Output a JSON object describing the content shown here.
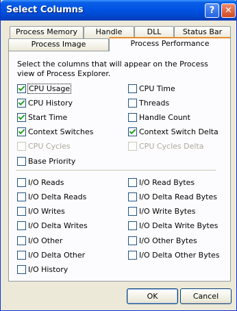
{
  "window": {
    "title": "Select Columns",
    "help_label": "?",
    "close_label": "✕"
  },
  "tabs_back": [
    {
      "label": "Process Memory"
    },
    {
      "label": "Handle"
    },
    {
      "label": "DLL"
    },
    {
      "label": "Status Bar"
    }
  ],
  "tabs_front": [
    {
      "label": "Process Image"
    },
    {
      "label": "Process Performance",
      "active": true
    }
  ],
  "description": "Select the columns that will appear on the Process view of Process Explorer.",
  "checkboxes": [
    {
      "label": "CPU Usage",
      "checked": true,
      "disabled": false
    },
    {
      "label": "CPU Time",
      "checked": false,
      "disabled": false
    },
    {
      "label": "CPU History",
      "checked": true,
      "disabled": false
    },
    {
      "label": "Threads",
      "checked": false,
      "disabled": false
    },
    {
      "label": "Start Time",
      "checked": true,
      "disabled": false
    },
    {
      "label": "Handle Count",
      "checked": false,
      "disabled": false
    },
    {
      "label": "Context Switches",
      "checked": true,
      "disabled": false
    },
    {
      "label": "Context Switch Delta",
      "checked": true,
      "disabled": false
    },
    {
      "label": "CPU Cycles",
      "checked": false,
      "disabled": true
    },
    {
      "label": "CPU Cycles Delta",
      "checked": false,
      "disabled": true
    },
    {
      "label": "Base Priority",
      "checked": false,
      "disabled": false
    },
    {
      "label": "I/O Reads",
      "checked": false,
      "disabled": false
    },
    {
      "label": "I/O Read Bytes",
      "checked": false,
      "disabled": false
    },
    {
      "label": "I/O Delta Reads",
      "checked": false,
      "disabled": false
    },
    {
      "label": "I/O Delta Read Bytes",
      "checked": false,
      "disabled": false
    },
    {
      "label": "I/O Writes",
      "checked": false,
      "disabled": false
    },
    {
      "label": "I/O Write Bytes",
      "checked": false,
      "disabled": false
    },
    {
      "label": "I/O Delta Writes",
      "checked": false,
      "disabled": false
    },
    {
      "label": "I/O Delta Write Bytes",
      "checked": false,
      "disabled": false
    },
    {
      "label": "I/O Other",
      "checked": false,
      "disabled": false
    },
    {
      "label": "I/O Other Bytes",
      "checked": false,
      "disabled": false
    },
    {
      "label": "I/O Delta Other",
      "checked": false,
      "disabled": false
    },
    {
      "label": "I/O Delta Other Bytes",
      "checked": false,
      "disabled": false
    },
    {
      "label": "I/O History",
      "checked": false,
      "disabled": false
    }
  ],
  "buttons": {
    "ok": "OK",
    "cancel": "Cancel"
  }
}
